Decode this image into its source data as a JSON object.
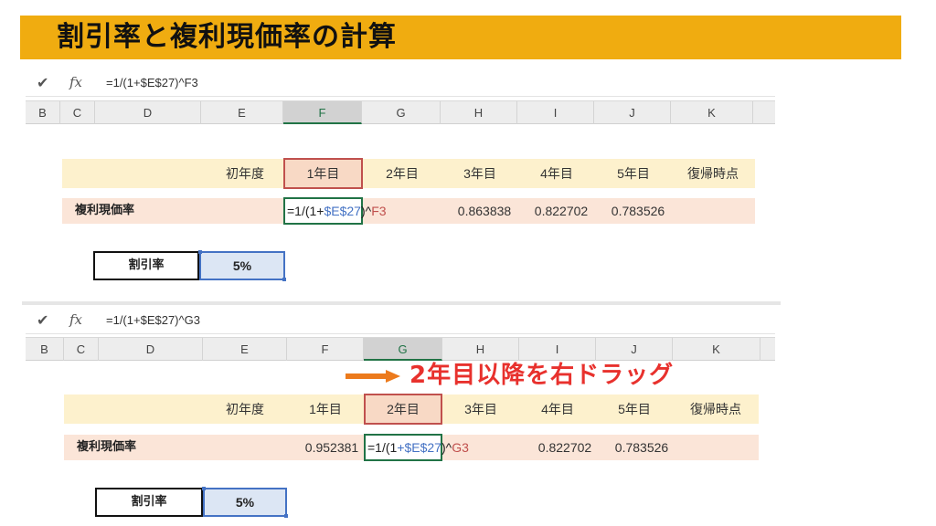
{
  "title": "割引率と複利現価率の計算",
  "columns": [
    "B",
    "C",
    "D",
    "E",
    "F",
    "G",
    "H",
    "I",
    "J",
    "K"
  ],
  "panel1": {
    "formula": "=1/(1+$E$27)^F3",
    "active_column": "F",
    "year_headers": [
      "初年度",
      "1年目",
      "2年目",
      "3年目",
      "4年目",
      "5年目",
      "復帰時点"
    ],
    "row_label": "複利現価率",
    "edit_formula_parts": [
      "=1/(1+",
      "$E$27",
      ")^",
      "F3"
    ],
    "values": [
      "0.863838",
      "0.822702",
      "0.783526"
    ],
    "discount_label": "割引率",
    "discount_value": "5%"
  },
  "panel2": {
    "formula": "=1/(1+$E$27)^G3",
    "active_column": "G",
    "year_headers": [
      "初年度",
      "1年目",
      "2年目",
      "3年目",
      "4年目",
      "5年目",
      "復帰時点"
    ],
    "row_label": "複利現価率",
    "f_value": "0.952381",
    "edit_formula_parts": [
      "=1/(1",
      "+$E$27",
      ")^",
      "G3"
    ],
    "values": [
      "0.822702",
      "0.783526"
    ],
    "discount_label": "割引率",
    "discount_value": "5%"
  },
  "annotation": "2年目以降を右ドラッグ",
  "colors": {
    "title_bg": "#f0ac10",
    "yellow_band": "#fdf1cd",
    "pink_band": "#fbe5d8",
    "highlight_border": "#c0504d",
    "edit_border": "#217346",
    "ref_blue": "#4472c4",
    "annotation_red": "#e8312d",
    "arrow_orange": "#ec7a1c"
  },
  "icons": {
    "check": "check-icon",
    "fx": "fx-icon",
    "arrow": "arrow-right-icon"
  }
}
